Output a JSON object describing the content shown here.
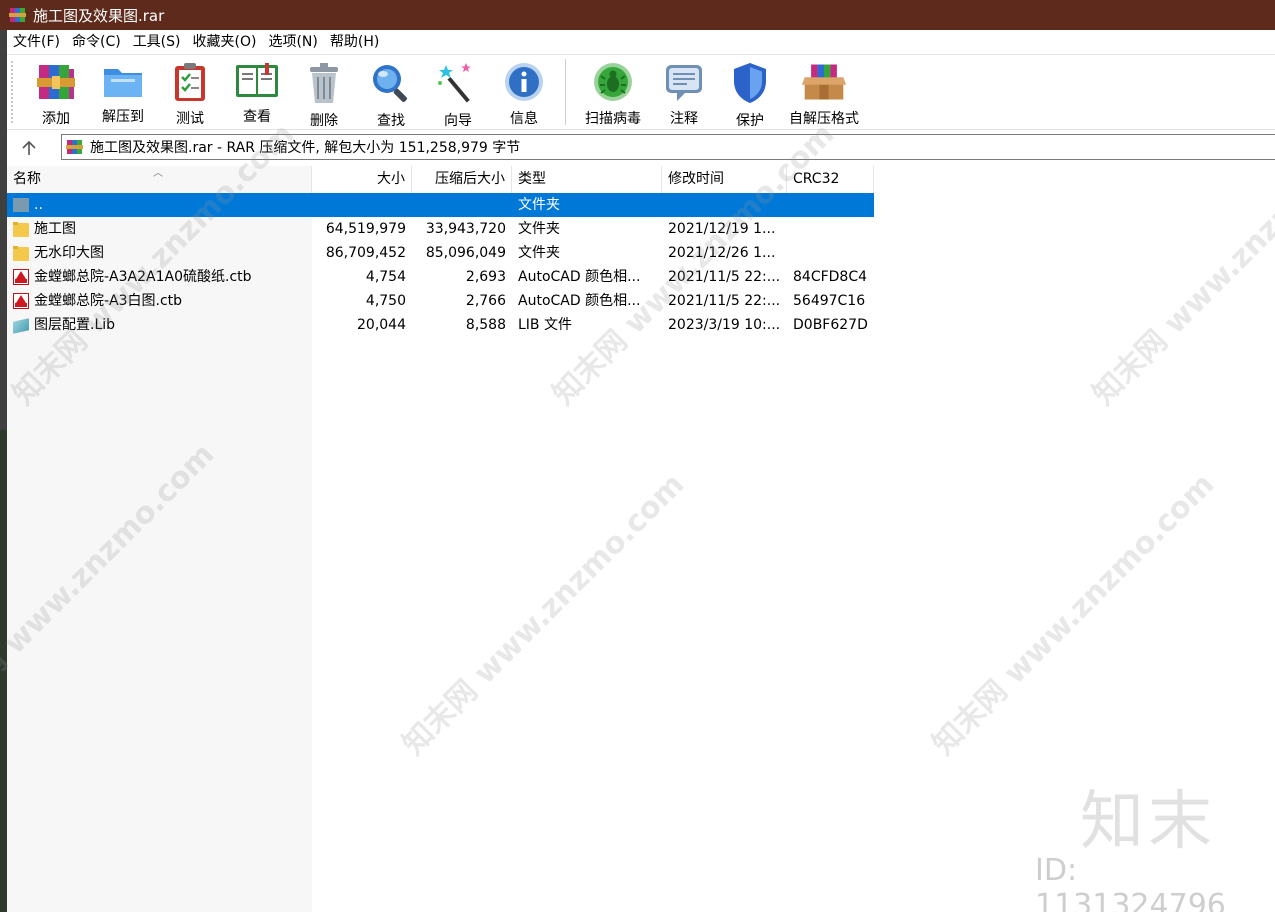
{
  "window": {
    "title": "施工图及效果图.rar"
  },
  "menu": [
    "文件(F)",
    "命令(C)",
    "工具(S)",
    "收藏夹(O)",
    "选项(N)",
    "帮助(H)"
  ],
  "toolbar": {
    "add": "添加",
    "extract": "解压到",
    "test": "测试",
    "view": "查看",
    "delete": "删除",
    "find": "查找",
    "wizard": "向导",
    "info": "信息",
    "virus": "扫描病毒",
    "comment": "注释",
    "protect": "保护",
    "sfx": "自解压格式"
  },
  "address": {
    "text": "施工图及效果图.rar - RAR 压缩文件, 解包大小为 151,258,979 字节"
  },
  "columns": {
    "name": "名称",
    "size": "大小",
    "packed": "压缩后大小",
    "type": "类型",
    "modified": "修改时间",
    "crc": "CRC32"
  },
  "rows": [
    {
      "name": "..",
      "size": "",
      "packed": "",
      "type": "文件夹",
      "modified": "",
      "crc": "",
      "icon": "up-folder-icon"
    },
    {
      "name": "施工图",
      "size": "64,519,979",
      "packed": "33,943,720",
      "type": "文件夹",
      "modified": "2021/12/19 1...",
      "crc": "",
      "icon": "folder-icon"
    },
    {
      "name": "无水印大图",
      "size": "86,709,452",
      "packed": "85,096,049",
      "type": "文件夹",
      "modified": "2021/12/26 1...",
      "crc": "",
      "icon": "folder-icon"
    },
    {
      "name": "金螳螂总院-A3A2A1A0硫酸纸.ctb",
      "size": "4,754",
      "packed": "2,693",
      "type": "AutoCAD 颜色相...",
      "modified": "2021/11/5 22:...",
      "crc": "84CFD8C4",
      "icon": "autocad-ctb-icon"
    },
    {
      "name": "金螳螂总院-A3白图.ctb",
      "size": "4,750",
      "packed": "2,766",
      "type": "AutoCAD 颜色相...",
      "modified": "2021/11/5 22:...",
      "crc": "56497C16",
      "icon": "autocad-ctb-icon"
    },
    {
      "name": "图层配置.Lib",
      "size": "20,044",
      "packed": "8,588",
      "type": "LIB 文件",
      "modified": "2023/3/19 10:...",
      "crc": "D0BF627D",
      "icon": "lib-file-icon"
    }
  ],
  "watermarks": {
    "site": "知末网 www.znzmo.com",
    "logo": "知末",
    "id": "ID: 1131324796"
  }
}
